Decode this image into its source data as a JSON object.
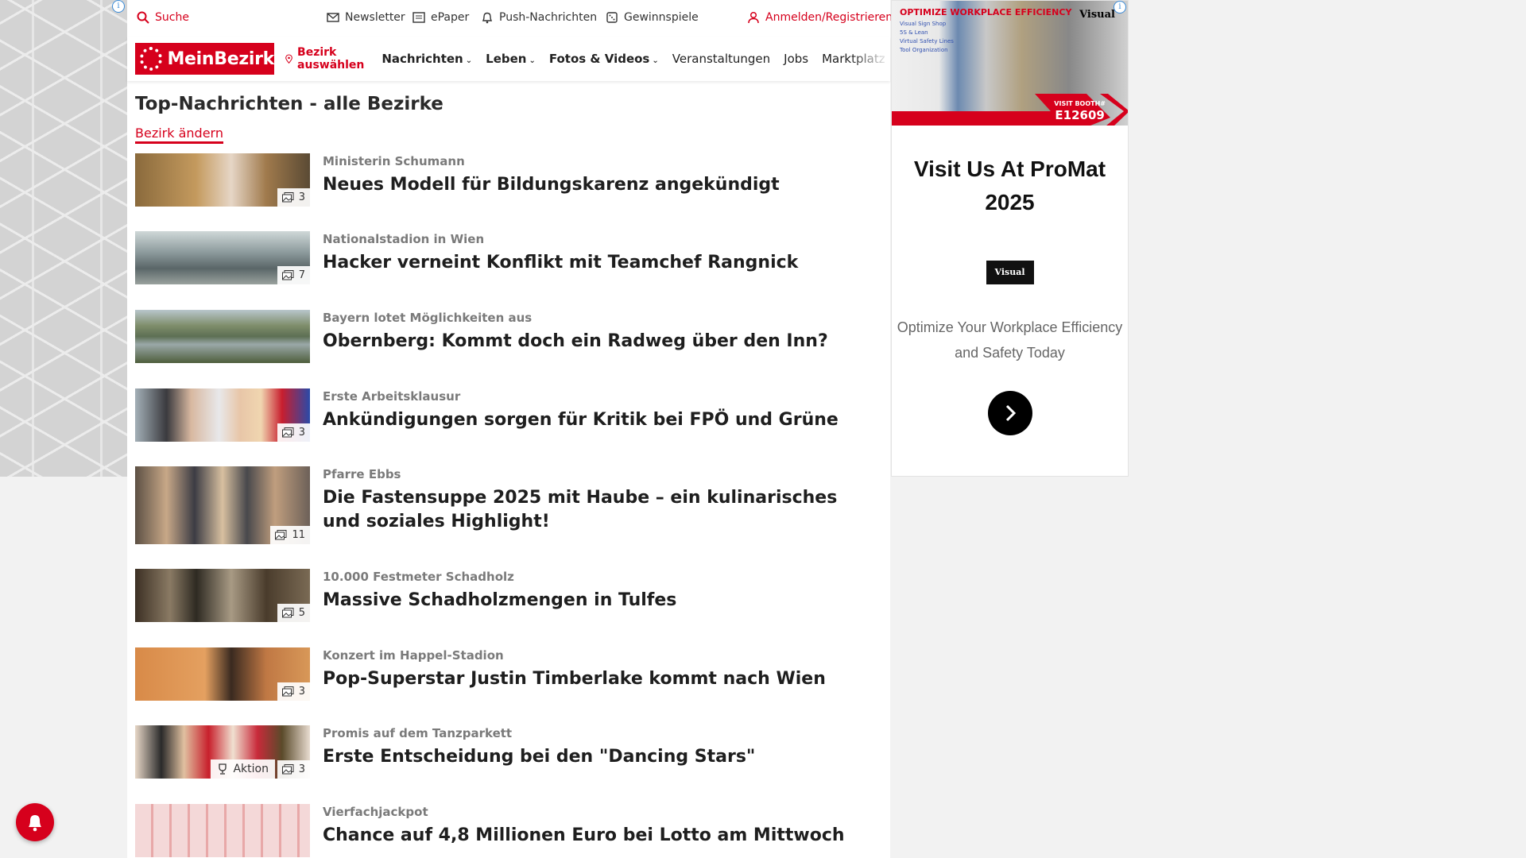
{
  "topbar": {
    "search": "Suche",
    "newsletter": "Newsletter",
    "epaper": "ePaper",
    "push": "Push-Nachrichten",
    "games": "Gewinnspiele",
    "login": "Anmelden/Registrieren"
  },
  "nav": {
    "logo": "MeinBezirk",
    "pick_district": "Bezirk auswählen",
    "items": [
      "Nachrichten",
      "Leben",
      "Fotos & Videos",
      "Veranstaltungen",
      "Jobs",
      "Marktplatz"
    ]
  },
  "page": {
    "title": "Top-Nachrichten - alle Bezirke",
    "change_link": "Bezirk ändern"
  },
  "articles": [
    {
      "kicker": "Ministerin Schumann",
      "headline": "Neues Modell für Bildungskarenz angekündigt",
      "photos": "3"
    },
    {
      "kicker": "Nationalstadion in Wien",
      "headline": "Hacker verneint Konflikt mit Teamchef Rangnick",
      "photos": "7"
    },
    {
      "kicker": "Bayern lotet Möglichkeiten aus",
      "headline": "Obernberg: Kommt doch ein Radweg über den Inn?",
      "photos": ""
    },
    {
      "kicker": "Erste Arbeitsklausur",
      "headline": "Ankündigungen sorgen für Kritik bei FPÖ und Grüne",
      "photos": "3"
    },
    {
      "kicker": "Pfarre Ebbs",
      "headline": "Die Fastensuppe 2025 mit Haube – ein kulinarisches und soziales Highlight!",
      "photos": "11"
    },
    {
      "kicker": "10.000 Festmeter Schadholz",
      "headline": "Massive Schadholzmengen in Tulfes",
      "photos": "5"
    },
    {
      "kicker": "Konzert im Happel-Stadion",
      "headline": "Pop-Superstar Justin Timberlake kommt nach Wien",
      "photos": "3"
    },
    {
      "kicker": "Promis auf dem Tanzparkett",
      "headline": "Erste Entscheidung bei den \"Dancing Stars\"",
      "photos": "3",
      "aktion": "Aktion"
    },
    {
      "kicker": "Vierfachjackpot",
      "headline": "Chance auf 4,8 Millionen Euro bei Lotto am Mittwoch",
      "photos": ""
    }
  ],
  "ad": {
    "banner_headline": "OPTIMIZE WORKPLACE EFFICIENCY",
    "banner_lines": [
      "Visual Sign Shop",
      "5S & Lean",
      "Virtual Safety Lines",
      "Tool Organization"
    ],
    "banner_brand": "Visual",
    "banner_booth_label": "VISIT BOOTH#",
    "banner_booth": "E12609",
    "title": "Visit Us At ProMat 2025",
    "logo": "Visual",
    "text": "Optimize Your Workplace Efficiency and Safety Today"
  },
  "colors": {
    "brand_red": "#d6001c"
  }
}
